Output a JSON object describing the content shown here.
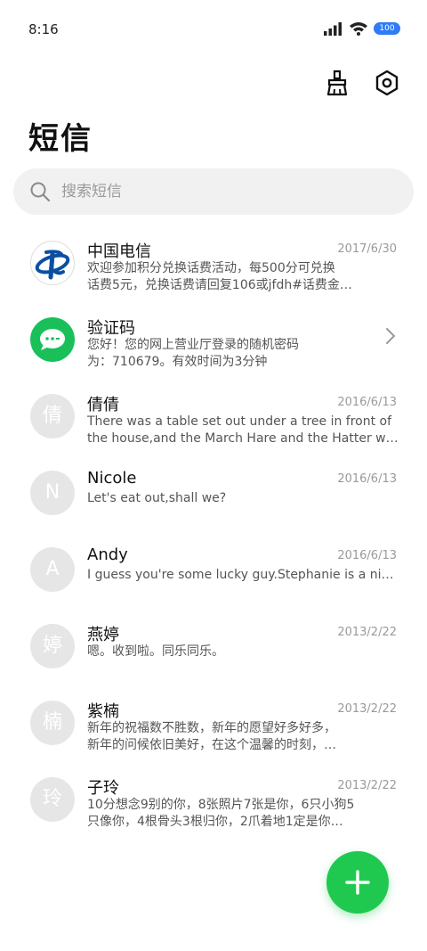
{
  "status_bar": {
    "time": "8:16",
    "battery": "100",
    "icons": [
      "signal-icon",
      "wifi-icon",
      "battery-icon"
    ]
  },
  "header": {
    "title": "短信",
    "actions": [
      {
        "icon": "broom-icon"
      },
      {
        "icon": "settings-hex-icon"
      }
    ]
  },
  "search": {
    "placeholder": "搜索短信",
    "value": ""
  },
  "messages": [
    {
      "name": "中国电信",
      "date": "2017/6/30",
      "avatar_text": "",
      "avatar_icon": "china-telecom-logo",
      "preview": [
        "欢迎参加积分兑换话费活动，每500分可兑换",
        "话费5元，兑换话费请回复106或jfdh#话费金…"
      ]
    },
    {
      "name": "验证码",
      "date": "",
      "avatar_text": "",
      "avatar_icon": "chat-bubble-icon",
      "preview": [
        "您好！您的网上营业厅登录的随机密码",
        "为：710679。有效时间为3分钟"
      ]
    },
    {
      "name": "倩倩",
      "date": "2016/6/13",
      "avatar_text": "倩",
      "preview": [
        "There was a table set out under a tree in front of",
        "the house,and the March Hare and the Hatter wer…"
      ]
    },
    {
      "name": "Nicole",
      "date": "2016/6/13",
      "avatar_text": "N",
      "preview": [
        "Let's eat out,shall we?"
      ]
    },
    {
      "name": "Andy",
      "date": "2016/6/13",
      "avatar_text": "A",
      "preview": [
        "I guess you're some lucky guy.Stephanie is a nice girl."
      ]
    },
    {
      "name": "燕婷",
      "date": "2013/2/22",
      "avatar_text": "婷",
      "preview": [
        "嗯。收到啦。同乐同乐。"
      ]
    },
    {
      "name": "紫楠",
      "date": "2013/2/22",
      "avatar_text": "楠",
      "preview": [
        "新年的祝福数不胜数，新年的愿望好多好多，",
        "新年的问候依旧美好，在这个温馨的时刻，…"
      ]
    },
    {
      "name": "子玲",
      "date": "2013/2/22",
      "avatar_text": "玲",
      "preview": [
        "10分想念9别的你，8张照片7张是你，6只小狗5",
        "只像你，4根骨头3根归你，2爪着地1定是你…"
      ]
    }
  ],
  "fab": {
    "icon": "plus-icon"
  },
  "colors": {
    "accent_green": "#1fc94f",
    "telecom_blue": "#0a4fa3",
    "avatar_gray": "#e6e6e6",
    "search_bg": "#f1f1f1"
  }
}
